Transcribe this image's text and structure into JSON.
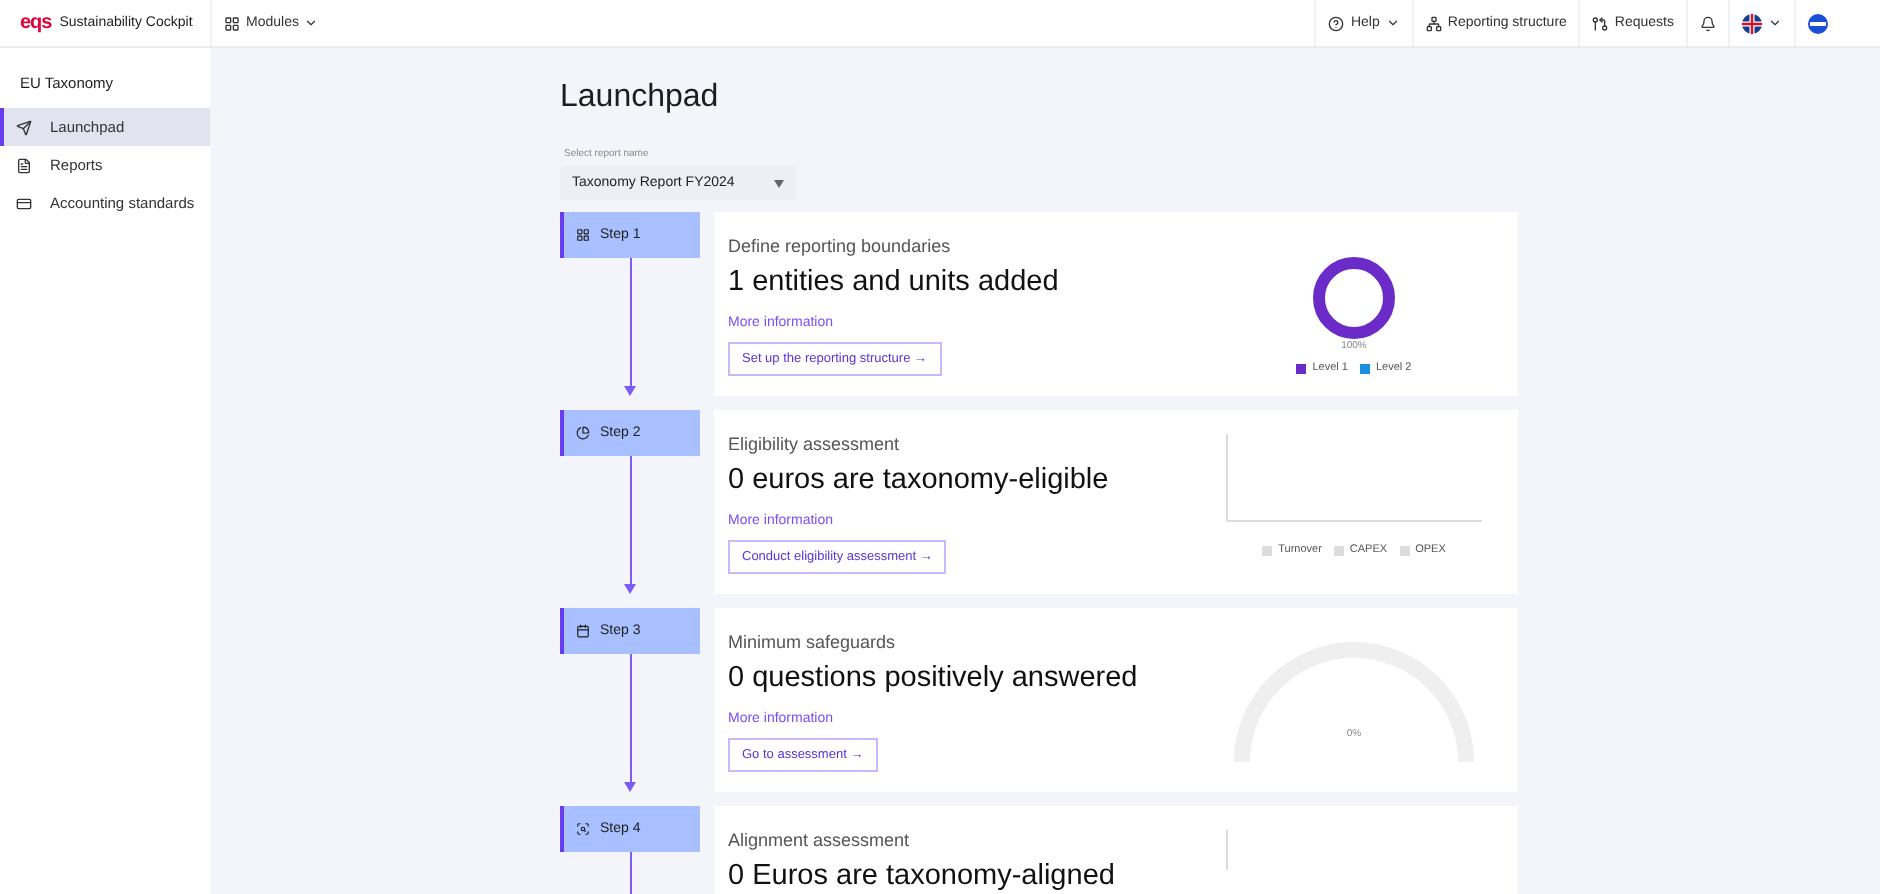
{
  "brand": {
    "logo": "eqs",
    "name": "Sustainability Cockpit"
  },
  "modules_menu": {
    "label": "Modules"
  },
  "topbar_items": [
    {
      "kind": "help",
      "label": "Help",
      "caret": true
    },
    {
      "kind": "structure",
      "label": "Reporting structure",
      "caret": false
    },
    {
      "kind": "requests",
      "label": "Requests",
      "caret": false
    },
    {
      "kind": "bell",
      "caret": false
    },
    {
      "kind": "flag",
      "caret": true
    },
    {
      "kind": "avatar",
      "caret": false
    }
  ],
  "sidebar": {
    "title": "EU Taxonomy",
    "items": [
      {
        "kind": "launch",
        "label": "Launchpad",
        "selected": true
      },
      {
        "kind": "report",
        "label": "Reports",
        "selected": false
      },
      {
        "kind": "standards",
        "label": "Accounting standards",
        "selected": false
      }
    ]
  },
  "page_title": "Launchpad",
  "report_select": {
    "label": "Select report name",
    "value": "Taxonomy Report FY2024"
  },
  "steps": [
    {
      "label": "Step 1",
      "kind": "structure",
      "title": "Define reporting boundaries",
      "headline": "1 entities and units added",
      "link": "More information",
      "button": "Set up the reporting structure →",
      "visual": {
        "kind": "donut",
        "value_label": "100%",
        "legend": [
          {
            "label": "Level 1",
            "color": "#6a2bc9"
          },
          {
            "label": "Level 2",
            "color": "#1a8fe0"
          }
        ]
      }
    },
    {
      "label": "Step 2",
      "kind": "pie",
      "title": "Eligibility assessment",
      "headline": "0 euros are taxonomy-eligible",
      "link": "More information",
      "button": "Conduct eligibility assessment →",
      "visual": {
        "kind": "axes",
        "legend": [
          {
            "label": "Turnover",
            "color": "#dddddd"
          },
          {
            "label": "CAPEX",
            "color": "#dddddd"
          },
          {
            "label": "OPEX",
            "color": "#dddddd"
          }
        ]
      }
    },
    {
      "label": "Step 3",
      "kind": "calendar",
      "title": "Minimum safeguards",
      "headline": "0 questions positively answered",
      "link": "More information",
      "button": "Go to assessment →",
      "visual": {
        "kind": "gauge",
        "value_label": "0%"
      }
    },
    {
      "label": "Step 4",
      "kind": "search",
      "title": "Alignment assessment",
      "headline": "0 Euros are taxonomy-aligned",
      "visual": {
        "kind": "axes_partial"
      }
    }
  ]
}
